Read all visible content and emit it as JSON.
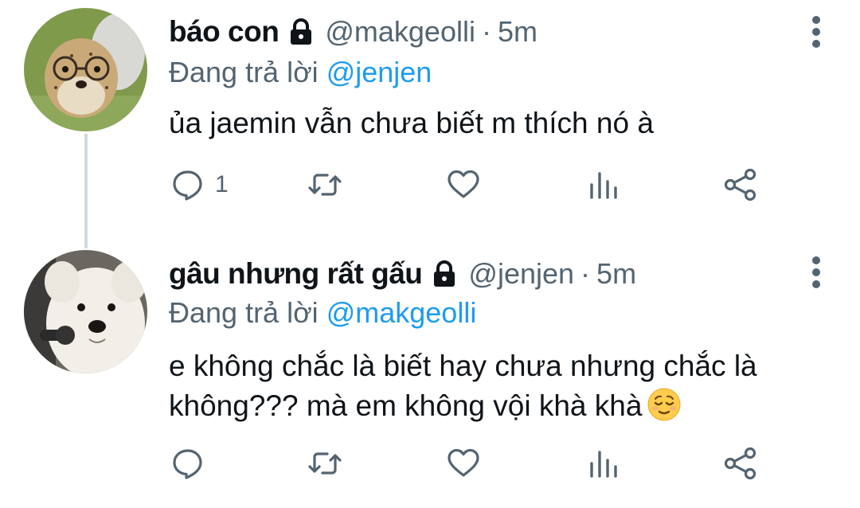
{
  "tweets": [
    {
      "display_name": "báo con",
      "protected": true,
      "handle": "@makgeolli",
      "separator": "·",
      "time": "5m",
      "reply_prefix": "Đang trả lời",
      "reply_to": "@jenjen",
      "text": "ủa jaemin vẫn chưa biết m thích nó à",
      "reply_count": "1",
      "avatar": "cheetah-cub-with-glasses"
    },
    {
      "display_name": "gâu nhưng rất gấu",
      "protected": true,
      "handle": "@jenjen",
      "separator": "·",
      "time": "5m",
      "reply_prefix": "Đang trả lời",
      "reply_to": "@makgeolli",
      "text": "e không chắc là biết hay chưa nhưng chắc là không??? mà em không vội khà khà",
      "emoji": "relieved-face",
      "reply_count": "",
      "avatar": "samoyed-with-microphone"
    }
  ],
  "colors": {
    "text_primary": "#0f1419",
    "text_secondary": "#536471",
    "mention": "#1d9bf0",
    "thread_line": "#cfd9de"
  },
  "icons": {
    "lock": "lock-icon",
    "more": "more-vertical-icon",
    "reply": "reply-bubble-icon",
    "retweet": "retweet-icon",
    "like": "heart-icon",
    "views": "views-bar-icon",
    "share": "share-icon"
  }
}
